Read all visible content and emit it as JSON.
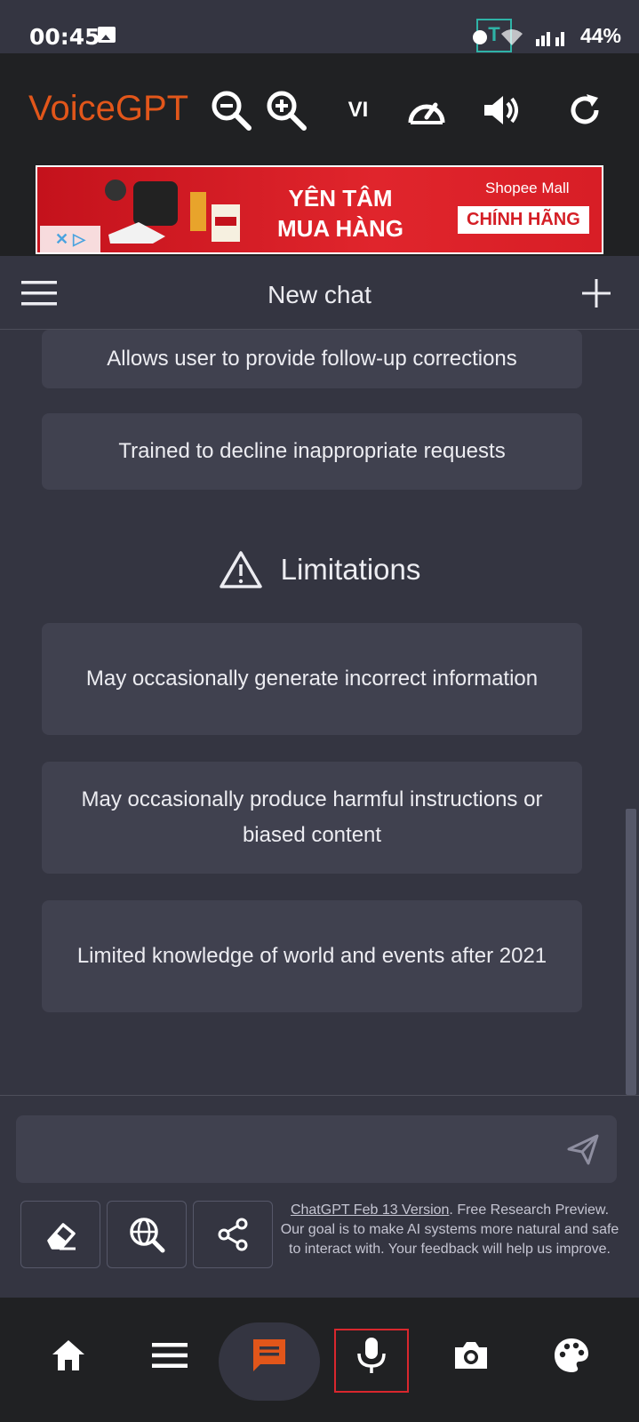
{
  "status_bar": {
    "time": "00:45",
    "battery": "44%",
    "watermark_letter": "T"
  },
  "app_bar": {
    "title": "VoiceGPT",
    "language": "VI",
    "accent_color": "#e2561a",
    "icons": [
      "zoom-out-icon",
      "zoom-in-icon",
      "speedometer-icon",
      "volume-icon",
      "refresh-icon"
    ]
  },
  "ad": {
    "headline_line1": "YÊN TÂM",
    "headline_line2": "MUA HÀNG",
    "brand": "Shopee Mall",
    "badge": "CHÍNH HÃNG"
  },
  "chat_header": {
    "title": "New chat"
  },
  "capabilities": [
    "Allows user to provide follow-up corrections",
    "Trained to decline inappropriate requests"
  ],
  "limitations": {
    "title": "Limitations",
    "items": [
      "May occasionally generate incorrect information",
      "May occasionally produce harmful instructions or biased content",
      "Limited knowledge of world and events after 2021"
    ]
  },
  "input": {
    "placeholder": ""
  },
  "footer": {
    "version_link": "ChatGPT Feb 13 Version",
    "disclaimer": ". Free Research Preview. Our goal is to make AI systems more natural and safe to interact with. Your feedback will help us improve."
  },
  "bottom_nav": {
    "items": [
      "home-icon",
      "menu-icon",
      "chat-icon",
      "microphone-icon",
      "camera-icon",
      "palette-icon"
    ],
    "active": "chat-icon",
    "active_color": "#e2561a"
  }
}
